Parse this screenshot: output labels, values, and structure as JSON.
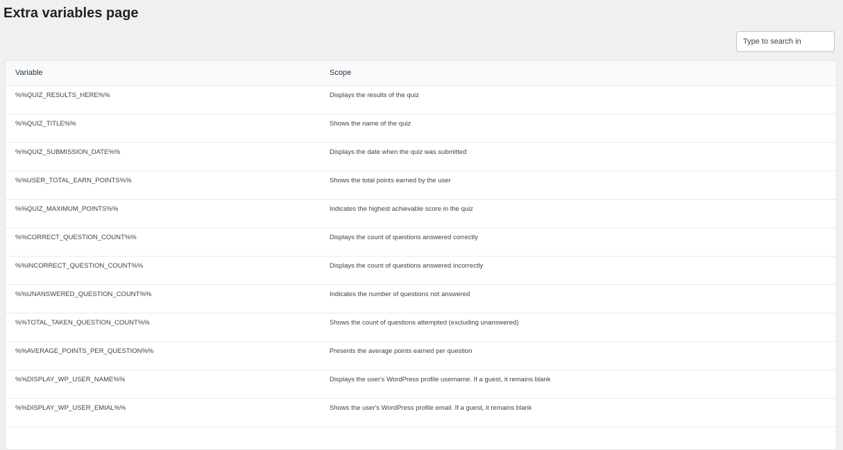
{
  "page": {
    "title": "Extra variables page"
  },
  "search": {
    "placeholder": "Type to search in"
  },
  "table": {
    "headers": {
      "variable": "Variable",
      "scope": "Scope"
    },
    "rows": [
      {
        "variable": "%%QUIZ_RESULTS_HERE%%",
        "scope": "Displays the results of the quiz"
      },
      {
        "variable": "%%QUIZ_TITLE%%",
        "scope": "Shows the name of the quiz"
      },
      {
        "variable": "%%QUIZ_SUBMISSION_DATE%%",
        "scope": "Displays the date when the quiz was submitted"
      },
      {
        "variable": "%%USER_TOTAL_EARN_POINTS%%",
        "scope": "Shows the total points earned by the user"
      },
      {
        "variable": "%%QUIZ_MAXIMUM_POINTS%%",
        "scope": "Indicates the highest achievable score in the quiz"
      },
      {
        "variable": "%%CORRECT_QUESTION_COUNT%%",
        "scope": "Displays the count of questions answered correctly"
      },
      {
        "variable": "%%INCORRECT_QUESTION_COUNT%%",
        "scope": "Displays the count of questions answered incorrectly"
      },
      {
        "variable": "%%UNANSWERED_QUESTION_COUNT%%",
        "scope": "Indicates the number of questions not answered"
      },
      {
        "variable": "%%TOTAL_TAKEN_QUESTION_COUNT%%",
        "scope": "Shows the count of questions attempted (excluding unanswered)"
      },
      {
        "variable": "%%AVERAGE_POINTS_PER_QUESTION%%",
        "scope": "Presents the average points earned per question"
      },
      {
        "variable": "%%DISPLAY_WP_USER_NAME%%",
        "scope": "Displays the user's WordPress profile username. If a guest, it remains blank"
      },
      {
        "variable": "%%DISPLAY_WP_USER_EMIAL%%",
        "scope": "Shows the user's WordPress profile email. If a guest, it remains blank"
      }
    ]
  }
}
